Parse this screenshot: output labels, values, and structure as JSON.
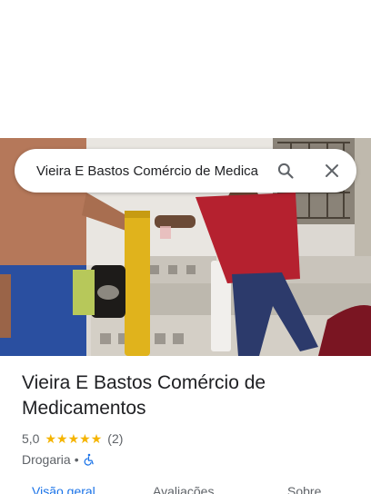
{
  "search": {
    "query": "Vieira E Bastos Comércio de Medica",
    "icons": {
      "search": "search-icon",
      "close": "close-icon"
    }
  },
  "place": {
    "name": "Vieira E Bastos Comércio de Medicamentos",
    "rating": "5,0",
    "stars": 5,
    "review_count": "(2)",
    "category": "Drogaria",
    "separator": "•",
    "accessibility_icon": "wheelchair-icon"
  },
  "tabs": [
    {
      "label": "Visão geral",
      "active": true
    },
    {
      "label": "Avaliações",
      "active": false
    },
    {
      "label": "Sobre",
      "active": false
    }
  ],
  "colors": {
    "accent": "#1a73e8",
    "star": "#f5b400",
    "text_secondary": "#5f6368"
  }
}
